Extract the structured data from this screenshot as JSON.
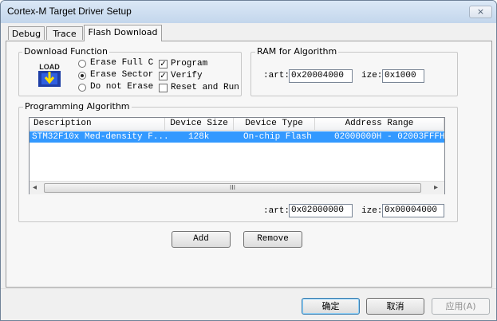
{
  "window": {
    "title": "Cortex-M Target Driver Setup",
    "close_label": "×"
  },
  "tabs": [
    {
      "label": "Debug"
    },
    {
      "label": "Trace"
    },
    {
      "label": "Flash Download",
      "active": true
    }
  ],
  "download_function": {
    "legend": "Download Function",
    "icon_text": "LOAD",
    "radios": [
      {
        "label": "Erase Full C",
        "selected": false
      },
      {
        "label": "Erase Sector",
        "selected": true
      },
      {
        "label": "Do not Erase",
        "selected": false
      }
    ],
    "checks": [
      {
        "label": "Program",
        "checked": true
      },
      {
        "label": "Verify",
        "checked": true
      },
      {
        "label": "Reset and Run",
        "checked": false
      }
    ],
    "check_mark": "✓"
  },
  "ram": {
    "legend": "RAM for Algorithm",
    "start_label": ":art:",
    "start_value": "0x20004000",
    "size_label": "ize:",
    "size_value": "0x1000"
  },
  "programming": {
    "legend": "Programming Algorithm",
    "columns": [
      "Description",
      "Device Size",
      "Device Type",
      "Address Range"
    ],
    "rows": [
      {
        "description": "STM32F10x Med-density F...",
        "size": "128k",
        "type": "On-chip Flash",
        "range": "02000000H - 02003FFFH"
      }
    ],
    "scroll_left": "◂",
    "scroll_right": "▸",
    "scroll_grip": "III",
    "start_label": ":art:",
    "start_value": "0x02000000",
    "size_label": "ize:",
    "size_value": "0x00004000"
  },
  "buttons": {
    "add": "Add",
    "remove": "Remove"
  },
  "footer": {
    "ok": "确定",
    "cancel": "取消",
    "apply": "应用(A)"
  },
  "colors": {
    "selection": "#3399ff",
    "titlebar": "#c3d6ec"
  }
}
